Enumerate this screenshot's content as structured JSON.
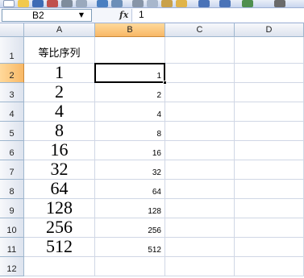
{
  "formula_bar": {
    "name_box": "B2",
    "fx_label": "fx",
    "formula_value": "1"
  },
  "toolbar": {
    "icons": [
      "new-icon",
      "open-icon",
      "save-icon",
      "permission-icon",
      "print-icon",
      "print-preview-icon",
      "spelling-icon",
      "research-icon",
      "cut-icon",
      "copy-icon",
      "paste-icon",
      "format-painter-icon",
      "undo-icon",
      "redo-icon",
      "hyperlink-icon",
      "autosum-icon"
    ]
  },
  "columns": [
    "A",
    "B",
    "C",
    "D"
  ],
  "rows": [
    "1",
    "2",
    "3",
    "4",
    "5",
    "6",
    "7",
    "8",
    "9",
    "10",
    "11",
    "12"
  ],
  "cells": {
    "a1": "等比序列",
    "a": [
      "1",
      "2",
      "4",
      "8",
      "16",
      "32",
      "64",
      "128",
      "256",
      "512"
    ],
    "b": [
      "1",
      "2",
      "4",
      "8",
      "16",
      "32",
      "64",
      "128",
      "256",
      "512"
    ]
  },
  "selection": {
    "cell": "B2",
    "column": "B",
    "row": "2"
  },
  "colors": {
    "selected_header": "#f8b866",
    "header": "#dde3ee",
    "gridline": "#d0d7e5"
  }
}
